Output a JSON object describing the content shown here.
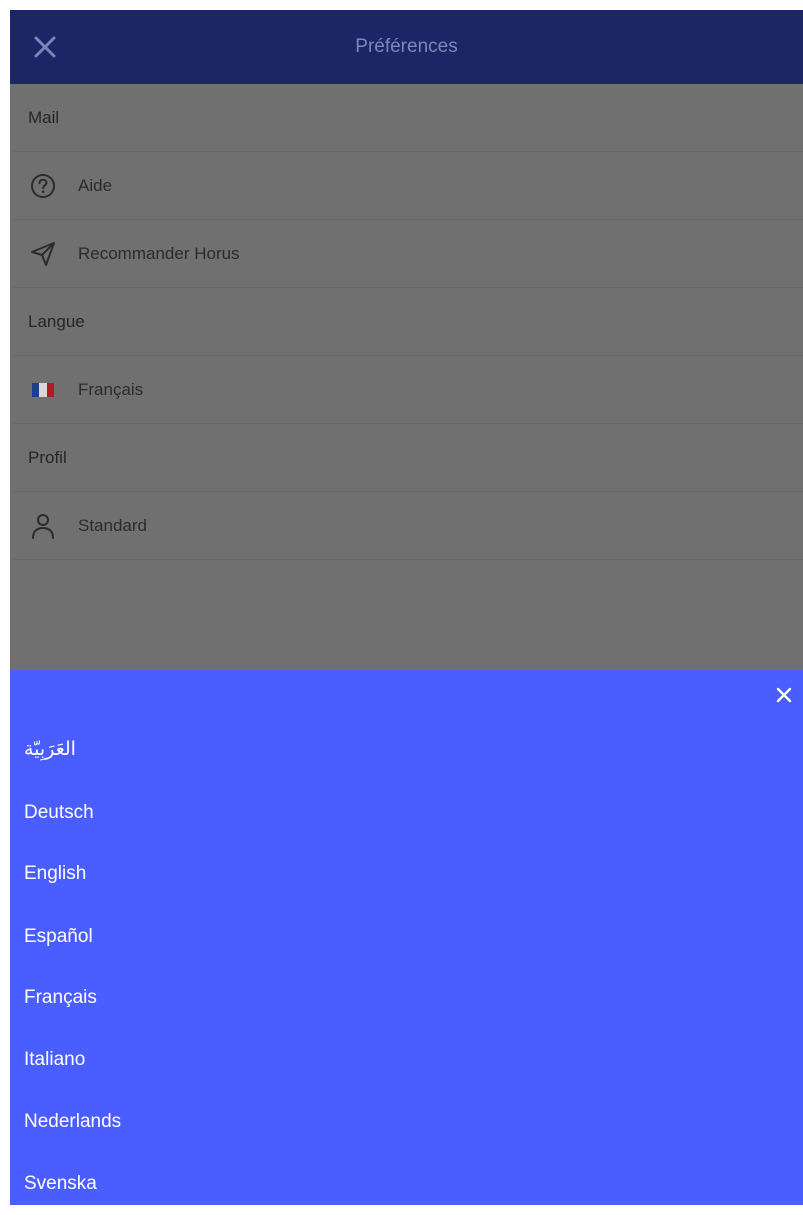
{
  "appbar": {
    "title": "Préférences",
    "close_icon": "close-icon"
  },
  "list": {
    "mail_header": "Mail",
    "help_label": "Aide",
    "recommend_label": "Recommander Horus",
    "language_header": "Langue",
    "language_label": "Français",
    "profile_header": "Profil",
    "profile_label": "Standard"
  },
  "sheet": {
    "languages": [
      "العَرَبِيّة",
      "Deutsch",
      "English",
      "Español",
      "Français",
      "Italiano",
      "Nederlands",
      "Svenska"
    ]
  },
  "colors": {
    "appbar": "#1c2566",
    "overlay": "#707070",
    "sheet": "#4a5eff",
    "flag_blue": "#1c3f8f",
    "flag_white": "#d8d8d8",
    "flag_red": "#b01c24"
  }
}
